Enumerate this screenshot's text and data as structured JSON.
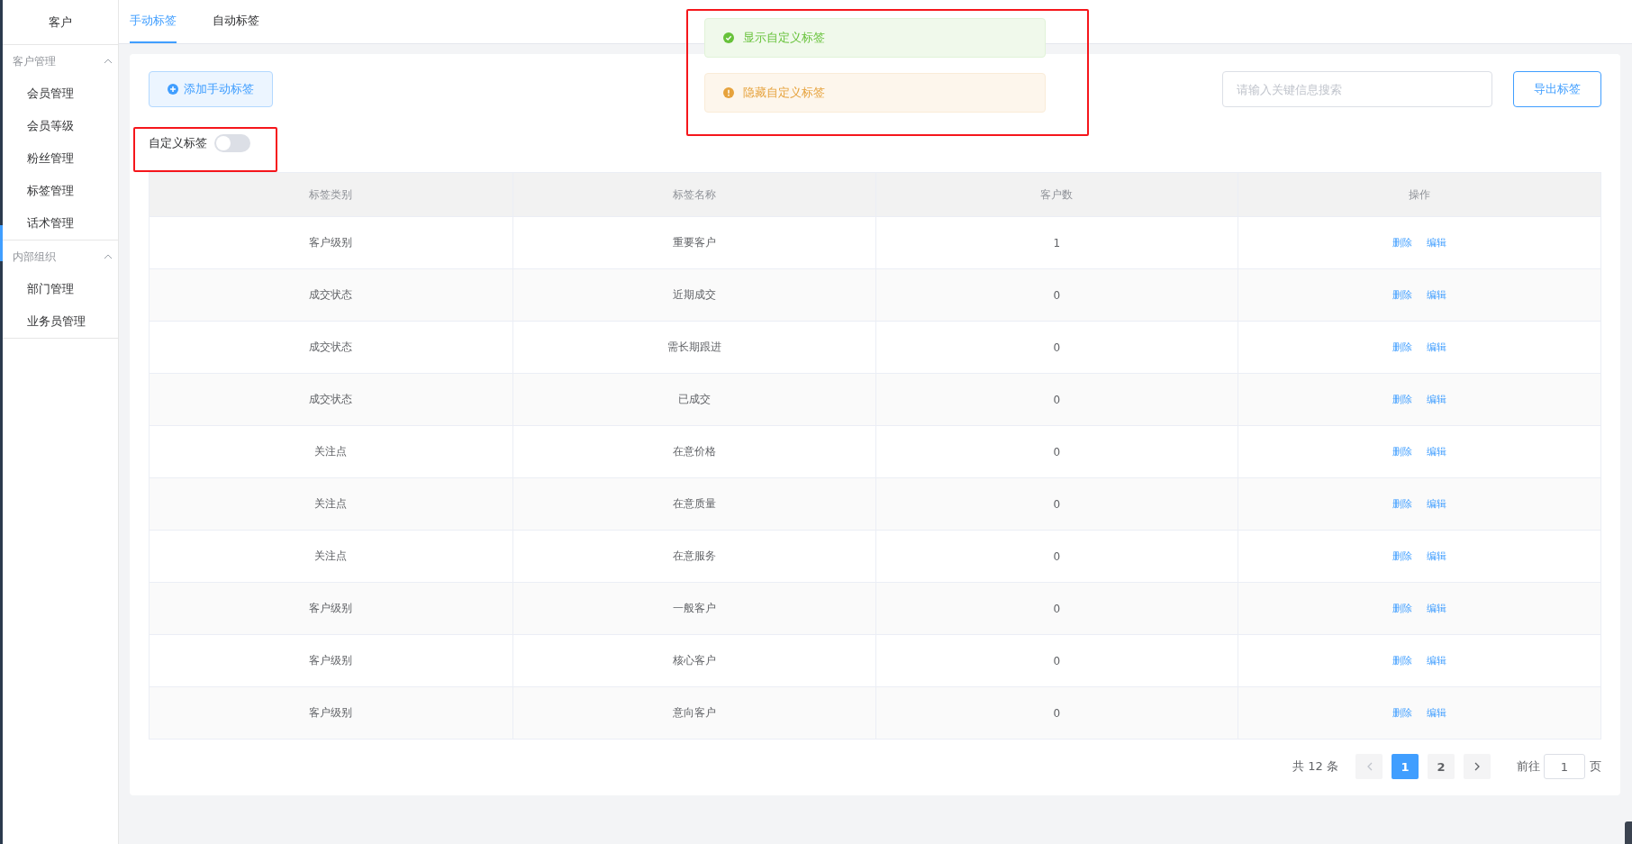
{
  "sidebar": {
    "title": "客户",
    "groups": [
      {
        "label": "客户管理",
        "expanded": true,
        "items": [
          {
            "label": "会员管理"
          },
          {
            "label": "会员等级"
          },
          {
            "label": "粉丝管理"
          },
          {
            "label": "标签管理"
          },
          {
            "label": "话术管理"
          }
        ]
      },
      {
        "label": "内部组织",
        "expanded": true,
        "items": [
          {
            "label": "部门管理"
          },
          {
            "label": "业务员管理"
          }
        ]
      }
    ]
  },
  "tabs": [
    {
      "label": "手动标签",
      "selected": true
    },
    {
      "label": "自动标签",
      "selected": false
    }
  ],
  "toasts": [
    {
      "kind": "success",
      "text": "显示自定义标签"
    },
    {
      "kind": "warning",
      "text": "隐藏自定义标签"
    }
  ],
  "add_button": "添加手动标签",
  "search": {
    "placeholder": "请输入关键信息搜索"
  },
  "export_button": "导出标签",
  "custom_switch": {
    "label": "自定义标签",
    "on": false
  },
  "table": {
    "columns": [
      "标签类别",
      "标签名称",
      "客户数",
      "操作"
    ],
    "rows": [
      {
        "category": "客户级别",
        "name": "重要客户",
        "count": "1",
        "actions": [
          "删除",
          "编辑"
        ]
      },
      {
        "category": "成交状态",
        "name": "近期成交",
        "count": "0",
        "actions": [
          "删除",
          "编辑"
        ]
      },
      {
        "category": "成交状态",
        "name": "需长期跟进",
        "count": "0",
        "actions": [
          "删除",
          "编辑"
        ]
      },
      {
        "category": "成交状态",
        "name": "已成交",
        "count": "0",
        "actions": [
          "删除",
          "编辑"
        ]
      },
      {
        "category": "关注点",
        "name": "在意价格",
        "count": "0",
        "actions": [
          "删除",
          "编辑"
        ]
      },
      {
        "category": "关注点",
        "name": "在意质量",
        "count": "0",
        "actions": [
          "删除",
          "编辑"
        ]
      },
      {
        "category": "关注点",
        "name": "在意服务",
        "count": "0",
        "actions": [
          "删除",
          "编辑"
        ]
      },
      {
        "category": "客户级别",
        "name": "一般客户",
        "count": "0",
        "actions": [
          "删除",
          "编辑"
        ]
      },
      {
        "category": "客户级别",
        "name": "核心客户",
        "count": "0",
        "actions": [
          "删除",
          "编辑"
        ]
      },
      {
        "category": "客户级别",
        "name": "意向客户",
        "count": "0",
        "actions": [
          "删除",
          "编辑"
        ]
      }
    ]
  },
  "pagination": {
    "total": "共 12 条",
    "prev_disabled": true,
    "next_disabled": false,
    "pages": [
      {
        "label": "1",
        "selected": true
      },
      {
        "label": "2",
        "selected": false
      }
    ],
    "goto_label": "前往",
    "goto_value": "1",
    "goto_suffix": "页"
  }
}
